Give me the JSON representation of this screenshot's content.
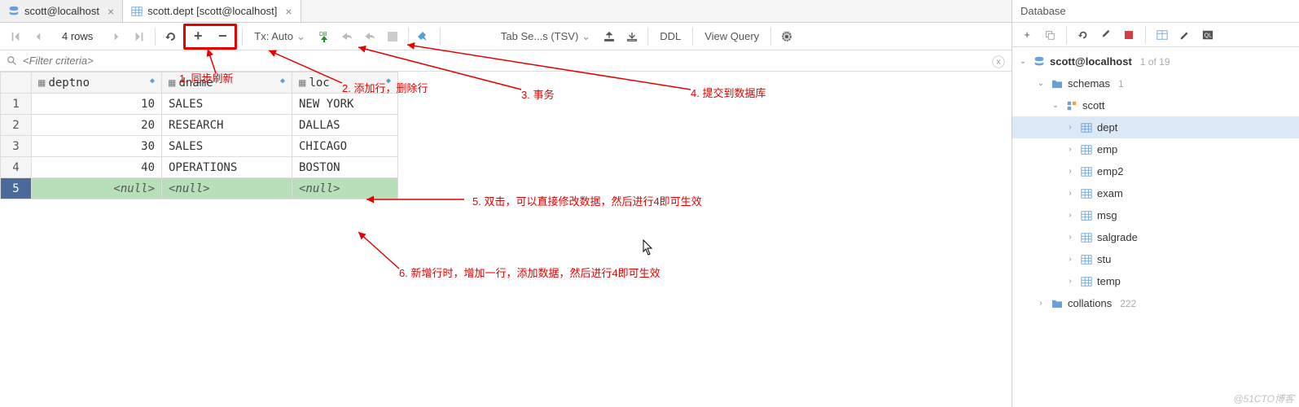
{
  "tabs": [
    {
      "label": "scott@localhost",
      "active": false
    },
    {
      "label": "scott.dept [scott@localhost]",
      "active": true
    }
  ],
  "toolbar": {
    "rowcount": "4 rows",
    "tx_mode": "Tx: Auto",
    "tab_sep": "Tab Se...s (TSV)",
    "ddl": "DDL",
    "view_query": "View Query"
  },
  "filter": {
    "placeholder": "<Filter criteria>"
  },
  "columns": [
    "deptno",
    "dname",
    "loc"
  ],
  "rows": [
    {
      "n": "1",
      "deptno": "10",
      "dname": "SALES",
      "loc": "NEW YORK"
    },
    {
      "n": "2",
      "deptno": "20",
      "dname": "RESEARCH",
      "loc": "DALLAS"
    },
    {
      "n": "3",
      "deptno": "30",
      "dname": "SALES",
      "loc": "CHICAGO"
    },
    {
      "n": "4",
      "deptno": "40",
      "dname": "OPERATIONS",
      "loc": "BOSTON"
    }
  ],
  "null_text": "<null>",
  "newrow_n": "5",
  "sidebar": {
    "title": "Database",
    "conn": "scott@localhost",
    "conn_meta": "1 of 19",
    "schemas_label": "schemas",
    "schemas_meta": "1",
    "schema_name": "scott",
    "tables": [
      "dept",
      "emp",
      "emp2",
      "exam",
      "msg",
      "salgrade",
      "stu",
      "temp"
    ],
    "collations_label": "collations",
    "collations_meta": "222"
  },
  "annotations": {
    "a1": "1. 同步刷新",
    "a2": "2. 添加行，删除行",
    "a3": "3. 事务",
    "a4": "4. 提交到数据库",
    "a5": "5. 双击，可以直接修改数据，然后进行4即可生效",
    "a6": "6. 新增行时，增加一行，添加数据，然后进行4即可生效"
  },
  "watermark": "@51CTO博客"
}
